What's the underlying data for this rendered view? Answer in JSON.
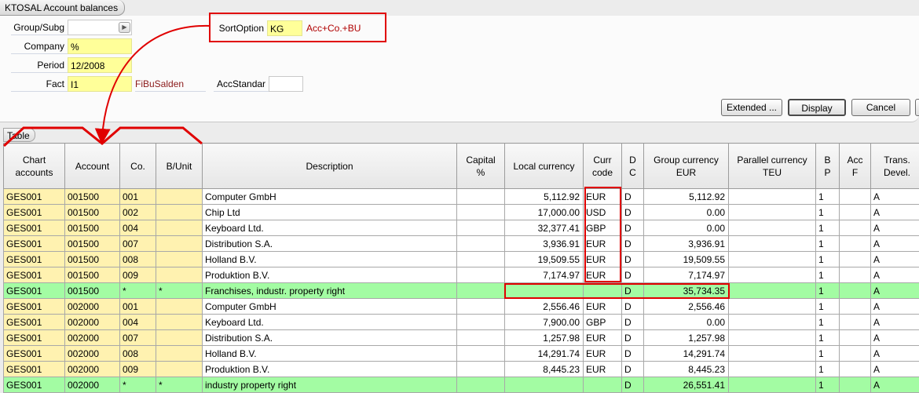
{
  "window": {
    "title": "KTOSAL Account balances"
  },
  "form": {
    "group_subg": {
      "label": "Group/Subg",
      "value": ""
    },
    "company": {
      "label": "Company",
      "value": "%"
    },
    "period": {
      "label": "Period",
      "value": "12/2008"
    },
    "fact": {
      "label": "Fact",
      "value": "I1",
      "aux": "FiBuSalden"
    },
    "acc_standard": {
      "label": "AccStandar",
      "value": ""
    },
    "sort_option": {
      "label": "SortOption",
      "value": "KG",
      "aux": "Acc+Co.+BU"
    }
  },
  "buttons": {
    "extended": "Extended ...",
    "display": "Display",
    "cancel": "Cancel"
  },
  "table": {
    "tab_label": "Table",
    "columns": [
      "Chart\naccounts",
      "Account",
      "Co.",
      "B/Unit",
      "Description",
      "Capital\n%",
      "Local currency",
      "Curr\ncode",
      "D\nC",
      "Group currency\nEUR",
      "Parallel currency\nTEU",
      "B\nP",
      "Acc\nF",
      "Trans.\nDevel."
    ],
    "rows": [
      {
        "chart": "GES001",
        "account": "001500",
        "co": "001",
        "bunit": "",
        "desc": "Computer GmbH",
        "capital": "",
        "local": "5,112.92",
        "curr": "EUR",
        "dc": "D",
        "group": "5,112.92",
        "parallel": "",
        "bp": "1",
        "accf": "",
        "trans": "A",
        "sum": false
      },
      {
        "chart": "GES001",
        "account": "001500",
        "co": "002",
        "bunit": "",
        "desc": "Chip Ltd",
        "capital": "",
        "local": "17,000.00",
        "curr": "USD",
        "dc": "D",
        "group": "0.00",
        "parallel": "",
        "bp": "1",
        "accf": "",
        "trans": "A",
        "sum": false
      },
      {
        "chart": "GES001",
        "account": "001500",
        "co": "004",
        "bunit": "",
        "desc": "Keyboard Ltd.",
        "capital": "",
        "local": "32,377.41",
        "curr": "GBP",
        "dc": "D",
        "group": "0.00",
        "parallel": "",
        "bp": "1",
        "accf": "",
        "trans": "A",
        "sum": false
      },
      {
        "chart": "GES001",
        "account": "001500",
        "co": "007",
        "bunit": "",
        "desc": "Distribution S.A.",
        "capital": "",
        "local": "3,936.91",
        "curr": "EUR",
        "dc": "D",
        "group": "3,936.91",
        "parallel": "",
        "bp": "1",
        "accf": "",
        "trans": "A",
        "sum": false
      },
      {
        "chart": "GES001",
        "account": "001500",
        "co": "008",
        "bunit": "",
        "desc": "Holland B.V.",
        "capital": "",
        "local": "19,509.55",
        "curr": "EUR",
        "dc": "D",
        "group": "19,509.55",
        "parallel": "",
        "bp": "1",
        "accf": "",
        "trans": "A",
        "sum": false
      },
      {
        "chart": "GES001",
        "account": "001500",
        "co": "009",
        "bunit": "",
        "desc": "Produktion B.V.",
        "capital": "",
        "local": "7,174.97",
        "curr": "EUR",
        "dc": "D",
        "group": "7,174.97",
        "parallel": "",
        "bp": "1",
        "accf": "",
        "trans": "A",
        "sum": false
      },
      {
        "chart": "GES001",
        "account": "001500",
        "co": "*",
        "bunit": "*",
        "desc": "Franchises, industr. property right",
        "capital": "",
        "local": "",
        "curr": "",
        "dc": "D",
        "group": "35,734.35",
        "parallel": "",
        "bp": "1",
        "accf": "",
        "trans": "A",
        "sum": true
      },
      {
        "chart": "GES001",
        "account": "002000",
        "co": "001",
        "bunit": "",
        "desc": "Computer GmbH",
        "capital": "",
        "local": "2,556.46",
        "curr": "EUR",
        "dc": "D",
        "group": "2,556.46",
        "parallel": "",
        "bp": "1",
        "accf": "",
        "trans": "A",
        "sum": false
      },
      {
        "chart": "GES001",
        "account": "002000",
        "co": "004",
        "bunit": "",
        "desc": "Keyboard Ltd.",
        "capital": "",
        "local": "7,900.00",
        "curr": "GBP",
        "dc": "D",
        "group": "0.00",
        "parallel": "",
        "bp": "1",
        "accf": "",
        "trans": "A",
        "sum": false
      },
      {
        "chart": "GES001",
        "account": "002000",
        "co": "007",
        "bunit": "",
        "desc": "Distribution S.A.",
        "capital": "",
        "local": "1,257.98",
        "curr": "EUR",
        "dc": "D",
        "group": "1,257.98",
        "parallel": "",
        "bp": "1",
        "accf": "",
        "trans": "A",
        "sum": false
      },
      {
        "chart": "GES001",
        "account": "002000",
        "co": "008",
        "bunit": "",
        "desc": "Holland B.V.",
        "capital": "",
        "local": "14,291.74",
        "curr": "EUR",
        "dc": "D",
        "group": "14,291.74",
        "parallel": "",
        "bp": "1",
        "accf": "",
        "trans": "A",
        "sum": false
      },
      {
        "chart": "GES001",
        "account": "002000",
        "co": "009",
        "bunit": "",
        "desc": "Produktion B.V.",
        "capital": "",
        "local": "8,445.23",
        "curr": "EUR",
        "dc": "D",
        "group": "8,445.23",
        "parallel": "",
        "bp": "1",
        "accf": "",
        "trans": "A",
        "sum": false
      },
      {
        "chart": "GES001",
        "account": "002000",
        "co": "*",
        "bunit": "*",
        "desc": "industry property right",
        "capital": "",
        "local": "",
        "curr": "",
        "dc": "D",
        "group": "26,551.41",
        "parallel": "",
        "bp": "1",
        "accf": "",
        "trans": "A",
        "sum": true
      }
    ]
  },
  "colors": {
    "highlight_red": "#e00000",
    "sum_row_green": "#a3fca3",
    "key_column_yellow": "#fff2b0",
    "input_yellow": "#ffff99"
  }
}
